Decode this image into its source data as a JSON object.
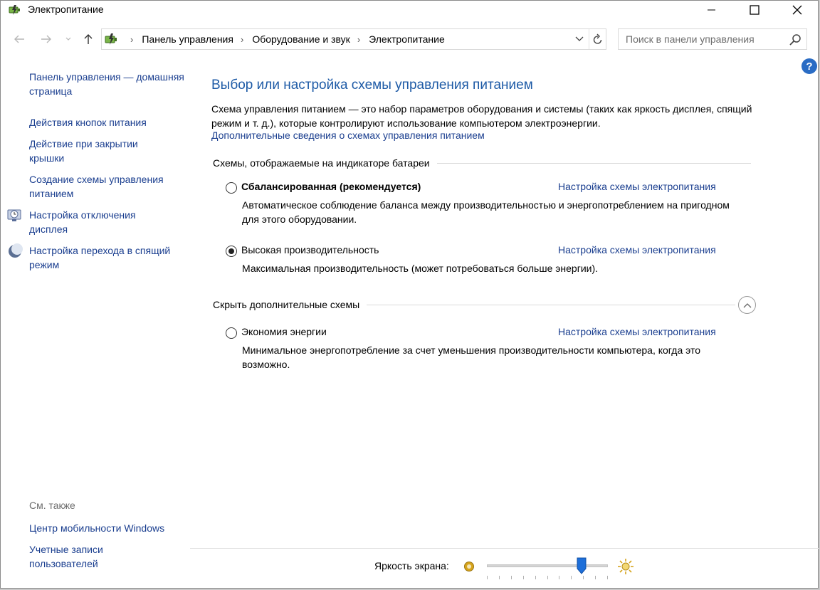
{
  "window": {
    "title": "Электропитание",
    "icon": "power-options-icon"
  },
  "nav": {
    "breadcrumbs": [
      "Панель управления",
      "Оборудование и звук",
      "Электропитание"
    ],
    "search_placeholder": "Поиск в панели управления"
  },
  "sidebar": {
    "home": "Панель управления — домашняя страница",
    "items": [
      {
        "label": "Действия кнопок питания",
        "icon": ""
      },
      {
        "label": "Действие при закрытии крышки",
        "icon": ""
      },
      {
        "label": "Создание схемы управления питанием",
        "icon": ""
      },
      {
        "label": "Настройка отключения дисплея",
        "icon": "display-clock-icon"
      },
      {
        "label": "Настройка перехода в спящий режим",
        "icon": "moon-icon"
      }
    ],
    "see_also": "См. также",
    "see_also_items": [
      "Центр мобильности Windows",
      "Учетные записи пользователей"
    ]
  },
  "main": {
    "title": "Выбор или настройка схемы управления питанием",
    "description": "Схема управления питанием — это набор параметров оборудования и системы (таких как яркость дисплея, спящий режим и т. д.), которые контролируют использование компьютером электроэнергии.",
    "more_link": "Дополнительные сведения о схемах управления питанием",
    "group_battery": "Схемы, отображаемые на индикаторе батареи",
    "group_hidden": "Скрыть дополнительные схемы",
    "plans": [
      {
        "name": "Сбалансированная (рекомендуется)",
        "bold": true,
        "checked": false,
        "link": "Настройка схемы электропитания",
        "desc": "Автоматическое соблюдение баланса между производительностью и энергопотреблением на пригодном для этого оборудовании."
      },
      {
        "name": "Высокая производительность",
        "bold": false,
        "checked": true,
        "link": "Настройка схемы электропитания",
        "desc": "Максимальная производительность (может потребоваться больше энергии)."
      },
      {
        "name": "Экономия энергии",
        "bold": false,
        "checked": false,
        "link": "Настройка схемы электропитания",
        "desc": "Минимальное энергопотребление за счет уменьшения производительности компьютера, когда это возможно."
      }
    ]
  },
  "brightness": {
    "label": "Яркость экрана:",
    "value": 0.78
  },
  "colors": {
    "link": "#1a3e8f",
    "title": "#1d5aa6",
    "accent": "#1e6fd9"
  }
}
